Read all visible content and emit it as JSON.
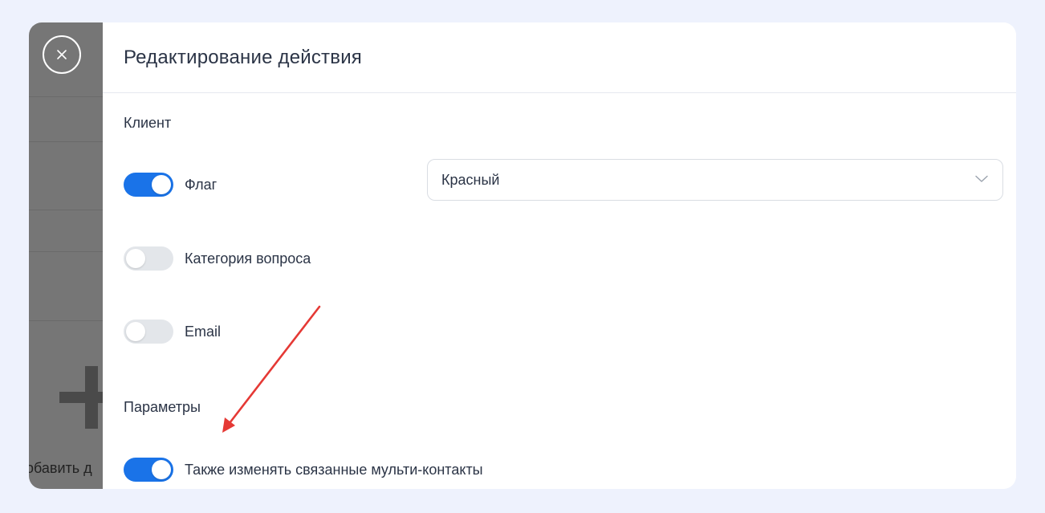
{
  "background_left": {
    "add_label": "обавить д"
  },
  "panel": {
    "title": "Редактирование действия"
  },
  "sections": {
    "client": {
      "title": "Клиент",
      "items": [
        {
          "label": "Флаг",
          "enabled": true
        },
        {
          "label": "Категория вопроса",
          "enabled": false
        },
        {
          "label": "Email",
          "enabled": false
        }
      ]
    },
    "params": {
      "title": "Параметры",
      "items": [
        {
          "label": "Также изменять связанные мульти-контакты",
          "enabled": true
        }
      ]
    }
  },
  "flag_select": {
    "value": "Красный"
  },
  "icons": {
    "close": "close-icon",
    "chevron": "chevron-down-icon",
    "plus": "plus-icon"
  },
  "colors": {
    "accent": "#1a73e8",
    "annotation_arrow": "#e53935",
    "page_background": "#eef2fd"
  }
}
